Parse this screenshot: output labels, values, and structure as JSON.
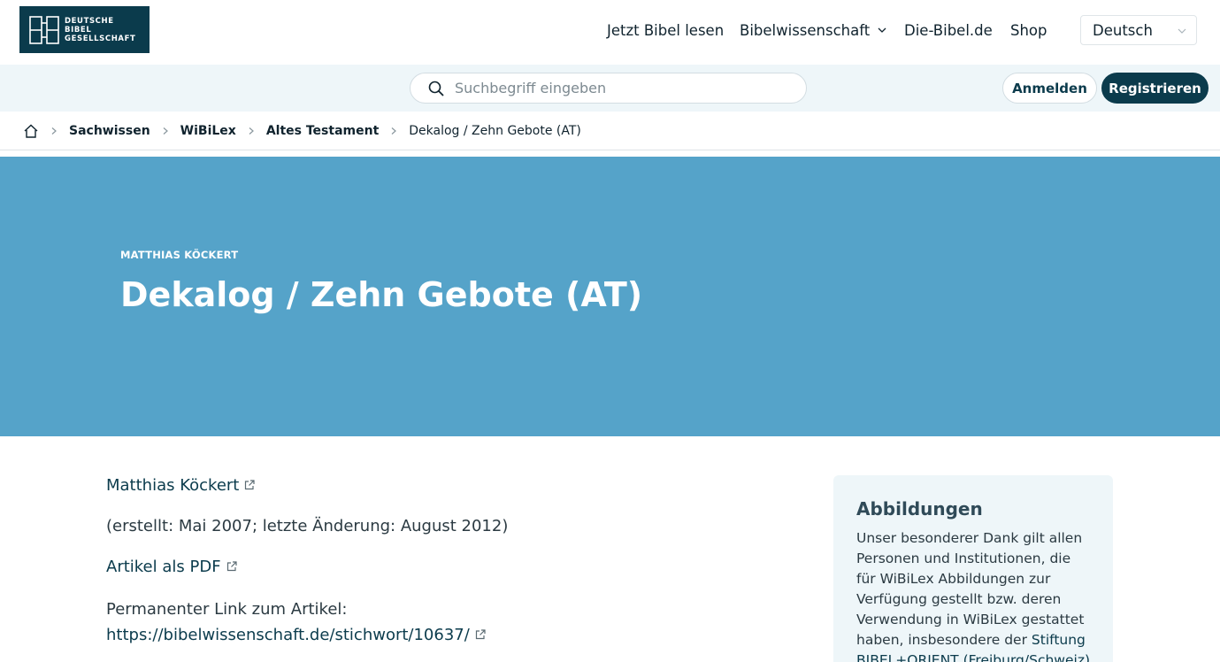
{
  "header": {
    "logo_lines": [
      "DEUTSCHE",
      "BIBEL",
      "GESELLSCHAFT"
    ],
    "nav": [
      {
        "label": "Jetzt Bibel lesen"
      },
      {
        "label": "Bibelwissenschaft"
      },
      {
        "label": "Die-Bibel.de"
      },
      {
        "label": "Shop"
      }
    ],
    "language": "Deutsch"
  },
  "searchbar": {
    "placeholder": "Suchbegriff eingeben",
    "login_label": "Anmelden",
    "register_label": "Registrieren"
  },
  "breadcrumb": {
    "items": [
      "Sachwissen",
      "WiBiLex",
      "Altes Testament"
    ],
    "current": "Dekalog / Zehn Gebote (AT)"
  },
  "hero": {
    "author": "MATTHIAS KÖCKERT",
    "title": "Dekalog / Zehn Gebote (AT)"
  },
  "article": {
    "author_link": "Matthias Köckert",
    "dates": "(erstellt: Mai 2007; letzte Änderung: August 2012)",
    "pdf_link": "Artikel als PDF",
    "permalink_label": "Permanenter Link zum Artikel:",
    "permalink_url": "https://bibelwissenschaft.de/stichwort/10637/"
  },
  "aside": {
    "title": "Abbildungen",
    "text": "Unser besonderer Dank gilt allen Personen und Institutionen, die für WiBiLex Abbildungen zur Verfügung gestellt bzw. deren Verwendung in WiBiLex gestattet haben, insbesondere der",
    "link": "Stiftung BIBEL+ORIENT (Freiburg/Schweiz)"
  },
  "icons": {
    "search": "search-icon",
    "home": "home-icon",
    "external": "external-link-icon",
    "chevron": "chevron-down-icon"
  },
  "colors": {
    "brand": "#0b3b4c",
    "hero": "#55a3c9",
    "band": "#eef6f9"
  }
}
